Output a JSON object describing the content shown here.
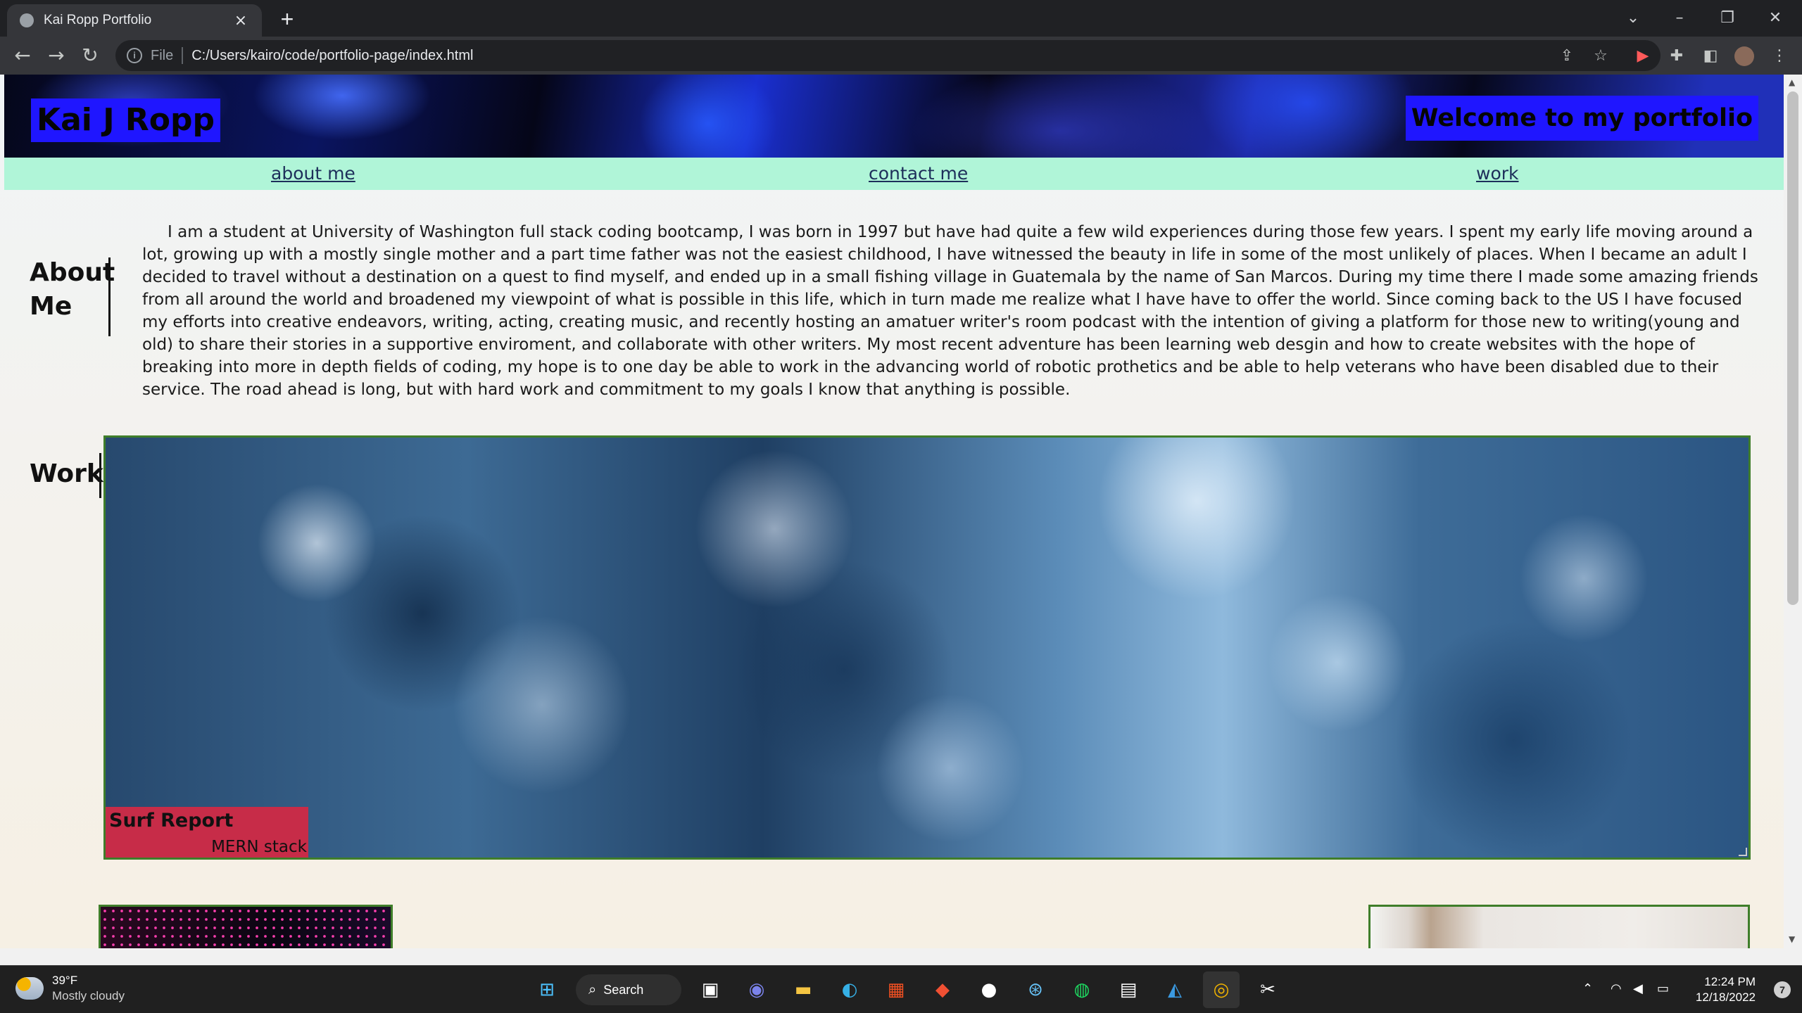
{
  "browser": {
    "tab_title": "Kai Ropp Portfolio",
    "tab_close": "×",
    "new_tab": "+",
    "scheme_label": "File",
    "url": "C:/Users/kairo/code/portfolio-page/index.html"
  },
  "site": {
    "title": "Kai J Ropp",
    "welcome": "Welcome to my portfolio",
    "nav": [
      {
        "label": "about me"
      },
      {
        "label": "contact me"
      },
      {
        "label": "work"
      }
    ],
    "about": {
      "heading": "About Me",
      "text": "I am a student at University of Washington full stack coding bootcamp, I was born in 1997 but have had quite a few wild experiences during those few years. I spent my early life moving around a lot, growing up with a mostly single mother and a part time father was not the easiest childhood, I have witnessed the beauty in life in some of the most unlikely of places. When I became an adult I decided to travel without a destination on a quest to find myself, and ended up in a small fishing village in Guatemala by the name of San Marcos. During my time there I made some amazing friends from all around the world and broadened my viewpoint of what is possible in this life, which in turn made me realize what I have have to offer the world. Since coming back to the US I have focused my efforts into creative endeavors, writing, acting, creating music, and recently hosting an amatuer writer's room podcast with the intention of giving a platform for those new to writing(young and old) to share their stories in a supportive enviroment, and collaborate with other writers. My most recent adventure has been learning web desgin and how to create websites with the hope of breaking into more in depth fields of coding, my hope is to one day be able to work in the advancing world of robotic prothetics and be able to help veterans who have been disabled due to their service. The road ahead is long, but with hard work and commitment to my goals I know that anything is possible."
    },
    "work": {
      "heading": "Work",
      "featured": {
        "name": "Surf Report",
        "tech": "MERN stack"
      }
    }
  },
  "taskbar": {
    "weather_temp": "39°F",
    "weather_condition": "Mostly cloudy",
    "search_label": "Search",
    "time": "12:24 PM",
    "date": "12/18/2022",
    "notification_count": "7"
  }
}
